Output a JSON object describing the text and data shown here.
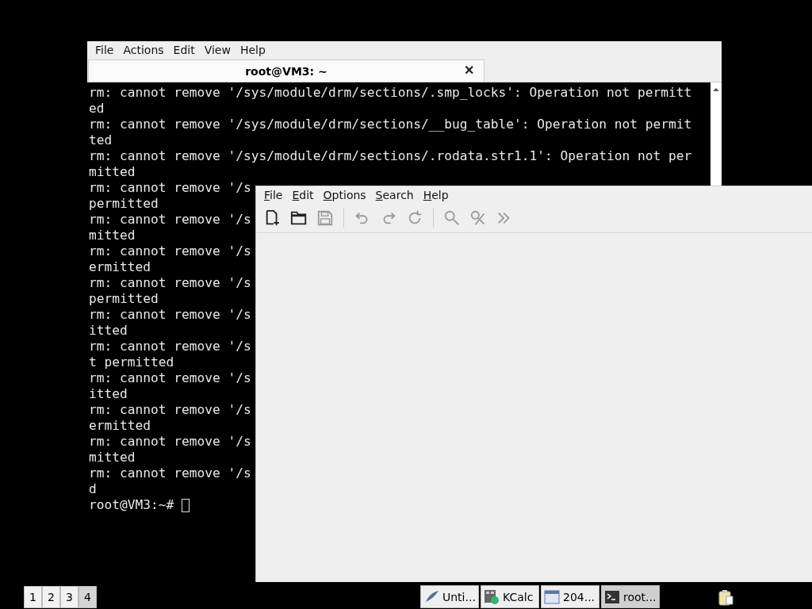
{
  "terminal": {
    "menu": [
      "File",
      "Actions",
      "Edit",
      "View",
      "Help"
    ],
    "tab": {
      "title": "root@VM3: ~",
      "close": "✕"
    },
    "lines": [
      "rm: cannot remove '/sys/module/drm/sections/.smp_locks': Operation not permitt",
      "ed",
      "rm: cannot remove '/sys/module/drm/sections/__bug_table': Operation not permit",
      "ted",
      "rm: cannot remove '/sys/module/drm/sections/.rodata.str1.1': Operation not per",
      "mitted",
      "rm: cannot remove '/s",
      "permitted",
      "rm: cannot remove '/s",
      "mitted",
      "rm: cannot remove '/s",
      "ermitted",
      "rm: cannot remove '/s",
      "permitted",
      "rm: cannot remove '/s",
      "itted",
      "rm: cannot remove '/s",
      "t permitted",
      "rm: cannot remove '/s",
      "itted",
      "rm: cannot remove '/s",
      "ermitted",
      "rm: cannot remove '/s",
      "mitted",
      "rm: cannot remove '/s",
      "d"
    ],
    "prompt": "root@VM3:~#"
  },
  "editor": {
    "menu": [
      "File",
      "Edit",
      "Options",
      "Search",
      "Help"
    ],
    "toolbar": [
      {
        "kind": "new",
        "disabled": false
      },
      {
        "kind": "open",
        "disabled": false
      },
      {
        "kind": "save",
        "disabled": true
      },
      {
        "kind": "sep"
      },
      {
        "kind": "undo",
        "disabled": true
      },
      {
        "kind": "redo",
        "disabled": true
      },
      {
        "kind": "reload",
        "disabled": true
      },
      {
        "kind": "sep"
      },
      {
        "kind": "find",
        "disabled": true
      },
      {
        "kind": "replace",
        "disabled": true
      },
      {
        "kind": "more",
        "disabled": true
      }
    ]
  },
  "taskbar": {
    "workspaces": [
      {
        "label": "1",
        "selected": false
      },
      {
        "label": "2",
        "selected": false
      },
      {
        "label": "3",
        "selected": false
      },
      {
        "label": "4",
        "selected": true
      }
    ],
    "tasks": [
      {
        "label": "Unti...",
        "kind": "editor",
        "selected": false
      },
      {
        "label": "KCalc",
        "kind": "calc",
        "selected": false
      },
      {
        "label": "204...",
        "kind": "window",
        "selected": false
      },
      {
        "label": "root...",
        "kind": "terminal",
        "selected": true
      }
    ]
  }
}
